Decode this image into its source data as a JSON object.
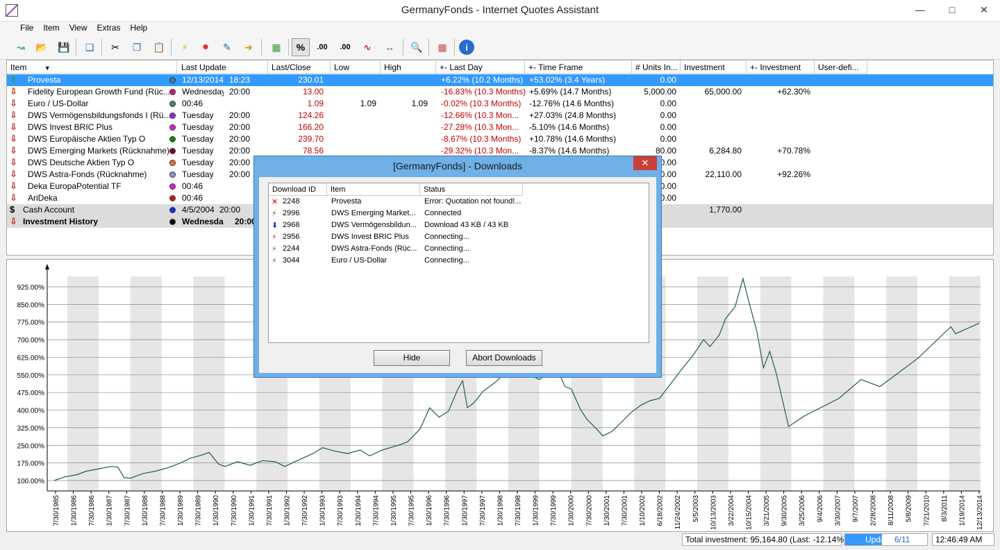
{
  "window": {
    "title": "GermanyFonds - Internet Quotes Assistant"
  },
  "menu": [
    "File",
    "Item",
    "View",
    "Extras",
    "Help"
  ],
  "toolbar": {
    "percent_label": "%",
    "decimals_more_label": ".00",
    "decimals_less_label": ".00"
  },
  "columns": [
    "Item",
    "Last Update",
    "Last/Close",
    "Low",
    "High",
    "+- Last Day",
    "+- Time Frame",
    "# Units In...",
    "Investment",
    "+- Investment",
    "User-defi..."
  ],
  "rows": [
    {
      "name": "Provesta",
      "date": "12/13/2014",
      "time": "18:23",
      "close": "230.01",
      "low": "",
      "high": "",
      "lastday": "+6.22% (10.2 Months)",
      "timeframe": "+53.02% (3.4 Years)",
      "units": "0.00",
      "investment": "",
      "inv_change": "",
      "dot_color": "#2e8b8b"
    },
    {
      "name": "Fidelity European Growth Fund (Rüc...",
      "date": "Wednesday",
      "time": "20:00",
      "close": "13.00",
      "low": "",
      "high": "",
      "lastday": "-16.83% (10.3 Months)",
      "timeframe": "+5.69% (14.7 Months)",
      "units": "5,000.00",
      "investment": "65,000.00",
      "inv_change": "+62.30%",
      "dot_color": "#d01870"
    },
    {
      "name": "Euro / US-Dollar",
      "date": "00:46",
      "time": "",
      "close": "1.09",
      "low": "1.09",
      "high": "1.09",
      "lastday": "-0.02% (10.3 Months)",
      "timeframe": "-12.76% (14.6 Months)",
      "units": "0.00",
      "investment": "",
      "inv_change": "",
      "dot_color": "#3a8a8a"
    },
    {
      "name": "DWS Vermögensbildungsfonds I (Rü...",
      "date": "Tuesday",
      "time": "20:00",
      "close": "124.26",
      "low": "",
      "high": "",
      "lastday": "-12.66% (10.3 Mon...",
      "timeframe": "+27.03% (24.8 Months)",
      "units": "0.00",
      "investment": "",
      "inv_change": "",
      "dot_color": "#a020f0"
    },
    {
      "name": "DWS Invest BRIC Plus",
      "date": "Tuesday",
      "time": "20:00",
      "close": "166.20",
      "low": "",
      "high": "",
      "lastday": "-27.28% (10.3 Mon...",
      "timeframe": "-5.10% (14.6 Months)",
      "units": "0.00",
      "investment": "",
      "inv_change": "",
      "dot_color": "#e020e0"
    },
    {
      "name": "DWS Europäische Aktien Typ O",
      "date": "Tuesday",
      "time": "20:00",
      "close": "239.70",
      "low": "",
      "high": "",
      "lastday": "-8.67% (10.3 Months)",
      "timeframe": "+10.78% (14.6 Months)",
      "units": "0.00",
      "investment": "",
      "inv_change": "",
      "dot_color": "#108a10"
    },
    {
      "name": "DWS Emerging Markets (Rücknahme)",
      "date": "Tuesday",
      "time": "20:00",
      "close": "78.56",
      "low": "",
      "high": "",
      "lastday": "-29.32% (10.3 Mon...",
      "timeframe": "-8.37% (14.6 Months)",
      "units": "80.00",
      "investment": "6,284.80",
      "inv_change": "+70.78%",
      "dot_color": "#800030"
    },
    {
      "name": "DWS Deutsche Aktien Typ O",
      "date": "Tuesday",
      "time": "20:00",
      "close": "",
      "low": "",
      "high": "",
      "lastday": "",
      "timeframe": "",
      "units": "0.00",
      "investment": "",
      "inv_change": "",
      "dot_color": "#f07030"
    },
    {
      "name": "DWS Astra-Fonds (Rücknahme)",
      "date": "Tuesday",
      "time": "20:00",
      "close": "",
      "low": "",
      "high": "",
      "lastday": "",
      "timeframe": "",
      "units": "0.00",
      "investment": "22,110.00",
      "inv_change": "+92.26%",
      "dot_color": "#9090e0"
    },
    {
      "name": "Deka EuropaPotential TF",
      "date": "00:46",
      "time": "",
      "close": "",
      "low": "",
      "high": "",
      "lastday": "",
      "timeframe": "",
      "units": "0.00",
      "investment": "",
      "inv_change": "",
      "dot_color": "#e020e0"
    },
    {
      "name": "AriDeka",
      "date": "00:46",
      "time": "",
      "close": "",
      "low": "",
      "high": "",
      "lastday": "",
      "timeframe": "",
      "units": "0.00",
      "investment": "",
      "inv_change": "",
      "dot_color": "#e01010"
    }
  ],
  "cash_row": {
    "name": "Cash Account",
    "date": "4/5/2004",
    "time": "20:00",
    "investment": "1,770.00",
    "dot_color": "#1030e0"
  },
  "history_row": {
    "name": "Investment History",
    "date": "Wednesday",
    "time": "20:00",
    "dot_color": "#000000"
  },
  "dialog": {
    "title": "[GermanyFonds] - Downloads",
    "close": "✕",
    "columns": [
      "Download ID",
      "Item",
      "Status"
    ],
    "rows": [
      {
        "icon": "error-icon",
        "id": "2248",
        "item": "Provesta",
        "status": "Error: Quotation not found!..."
      },
      {
        "icon": "plug-icon",
        "id": "2996",
        "item": "DWS Emerging Market...",
        "status": "Connected"
      },
      {
        "icon": "download-icon",
        "id": "2968",
        "item": "DWS Vermögensbildun...",
        "status": "Download 43 KB / 43 KB"
      },
      {
        "icon": "plug-icon",
        "id": "2956",
        "item": "DWS Invest BRIC Plus",
        "status": "Connecting..."
      },
      {
        "icon": "plug-icon",
        "id": "2244",
        "item": "DWS Astra-Fonds (Rüc...",
        "status": "Connecting..."
      },
      {
        "icon": "plug-icon",
        "id": "3044",
        "item": "Euro / US-Dollar",
        "status": "Connecting..."
      }
    ],
    "hide": "Hide",
    "abort": "Abort Downloads"
  },
  "status": {
    "total": "Total investment: 95,164.80 (Last: -12.14%)",
    "update": "Update",
    "progress": "6/11",
    "clock": "12:46:49 AM"
  },
  "chart_data": {
    "type": "line",
    "yticks": [
      "925.00%",
      "850.00%",
      "775.00%",
      "700.00%",
      "625.00%",
      "550.00%",
      "475.00%",
      "400.00%",
      "325.00%",
      "250.00%",
      "175.00%",
      "100.00%"
    ],
    "ylim": [
      100,
      925
    ],
    "xticks": [
      "7/30/1985",
      "1/30/1986",
      "7/30/1986",
      "1/30/1987",
      "7/30/1987",
      "1/30/1988",
      "7/30/1988",
      "1/30/1989",
      "7/30/1989",
      "1/30/1990",
      "7/30/1990",
      "1/30/1991",
      "7/30/1991",
      "1/30/1992",
      "7/30/1992",
      "1/30/1993",
      "7/30/1993",
      "1/30/1994",
      "7/30/1994",
      "1/30/1995",
      "7/30/1995",
      "1/30/1996",
      "7/30/1996",
      "1/30/1997",
      "7/30/1997",
      "1/30/1998",
      "7/30/1998",
      "1/30/1999",
      "7/30/1999",
      "1/30/2000",
      "7/30/2000",
      "1/30/2001",
      "7/30/2001",
      "1/10/2002",
      "6/18/2002",
      "11/24/2002",
      "5/5/2003",
      "10/13/2003",
      "3/22/2004",
      "10/15/2004",
      "3/21/2005",
      "9/30/2005",
      "3/25/2006",
      "9/4/2006",
      "3/30/2007",
      "9/7/2007",
      "2/28/2008",
      "8/11/2008",
      "5/8/2009",
      "7/21/2010",
      "8/3/2011",
      "1/19/2014",
      "12/13/2014"
    ],
    "series": [
      {
        "values": [
          [
            1985.58,
            100
          ],
          [
            1985.9,
            115
          ],
          [
            1986.3,
            125
          ],
          [
            1986.6,
            140
          ],
          [
            1987.0,
            150
          ],
          [
            1987.4,
            160
          ],
          [
            1987.6,
            158
          ],
          [
            1987.8,
            112
          ],
          [
            1988.0,
            110
          ],
          [
            1988.4,
            130
          ],
          [
            1988.8,
            140
          ],
          [
            1989.2,
            155
          ],
          [
            1989.6,
            175
          ],
          [
            1989.9,
            195
          ],
          [
            1990.3,
            210
          ],
          [
            1990.5,
            220
          ],
          [
            1990.8,
            170
          ],
          [
            1991.0,
            160
          ],
          [
            1991.4,
            180
          ],
          [
            1991.8,
            165
          ],
          [
            1992.2,
            185
          ],
          [
            1992.6,
            180
          ],
          [
            1992.9,
            160
          ],
          [
            1993.3,
            185
          ],
          [
            1993.8,
            215
          ],
          [
            1994.1,
            240
          ],
          [
            1994.5,
            225
          ],
          [
            1994.9,
            215
          ],
          [
            1995.3,
            230
          ],
          [
            1995.6,
            205
          ],
          [
            1996.0,
            230
          ],
          [
            1996.5,
            250
          ],
          [
            1996.8,
            265
          ],
          [
            1997.2,
            320
          ],
          [
            1997.5,
            410
          ],
          [
            1997.8,
            370
          ],
          [
            1998.1,
            395
          ],
          [
            1998.4,
            490
          ],
          [
            1998.55,
            525
          ],
          [
            1998.7,
            410
          ],
          [
            1998.9,
            430
          ],
          [
            1999.2,
            480
          ],
          [
            1999.6,
            520
          ],
          [
            1999.9,
            560
          ],
          [
            2000.2,
            600
          ],
          [
            2000.5,
            560
          ],
          [
            2001.0,
            530
          ],
          [
            2001.3,
            570
          ],
          [
            2001.6,
            560
          ],
          [
            2001.8,
            500
          ],
          [
            2002.0,
            490
          ],
          [
            2002.3,
            400
          ],
          [
            2002.5,
            360
          ],
          [
            2002.8,
            320
          ],
          [
            2003.0,
            290
          ],
          [
            2003.3,
            310
          ],
          [
            2003.6,
            350
          ],
          [
            2003.9,
            390
          ],
          [
            2004.2,
            420
          ],
          [
            2004.5,
            440
          ],
          [
            2004.8,
            450
          ],
          [
            2005.2,
            520
          ],
          [
            2005.6,
            590
          ],
          [
            2005.9,
            640
          ],
          [
            2006.2,
            700
          ],
          [
            2006.4,
            670
          ],
          [
            2006.7,
            720
          ],
          [
            2006.9,
            790
          ],
          [
            2007.2,
            840
          ],
          [
            2007.45,
            960
          ],
          [
            2007.6,
            880
          ],
          [
            2007.9,
            730
          ],
          [
            2008.1,
            580
          ],
          [
            2008.3,
            650
          ],
          [
            2008.5,
            560
          ],
          [
            2008.9,
            330
          ],
          [
            2009.4,
            375
          ],
          [
            2010.5,
            450
          ],
          [
            2011.2,
            530
          ],
          [
            2011.8,
            500
          ],
          [
            2013.0,
            620
          ],
          [
            2014.05,
            755
          ],
          [
            2014.2,
            725
          ],
          [
            2014.95,
            770
          ]
        ]
      }
    ]
  }
}
